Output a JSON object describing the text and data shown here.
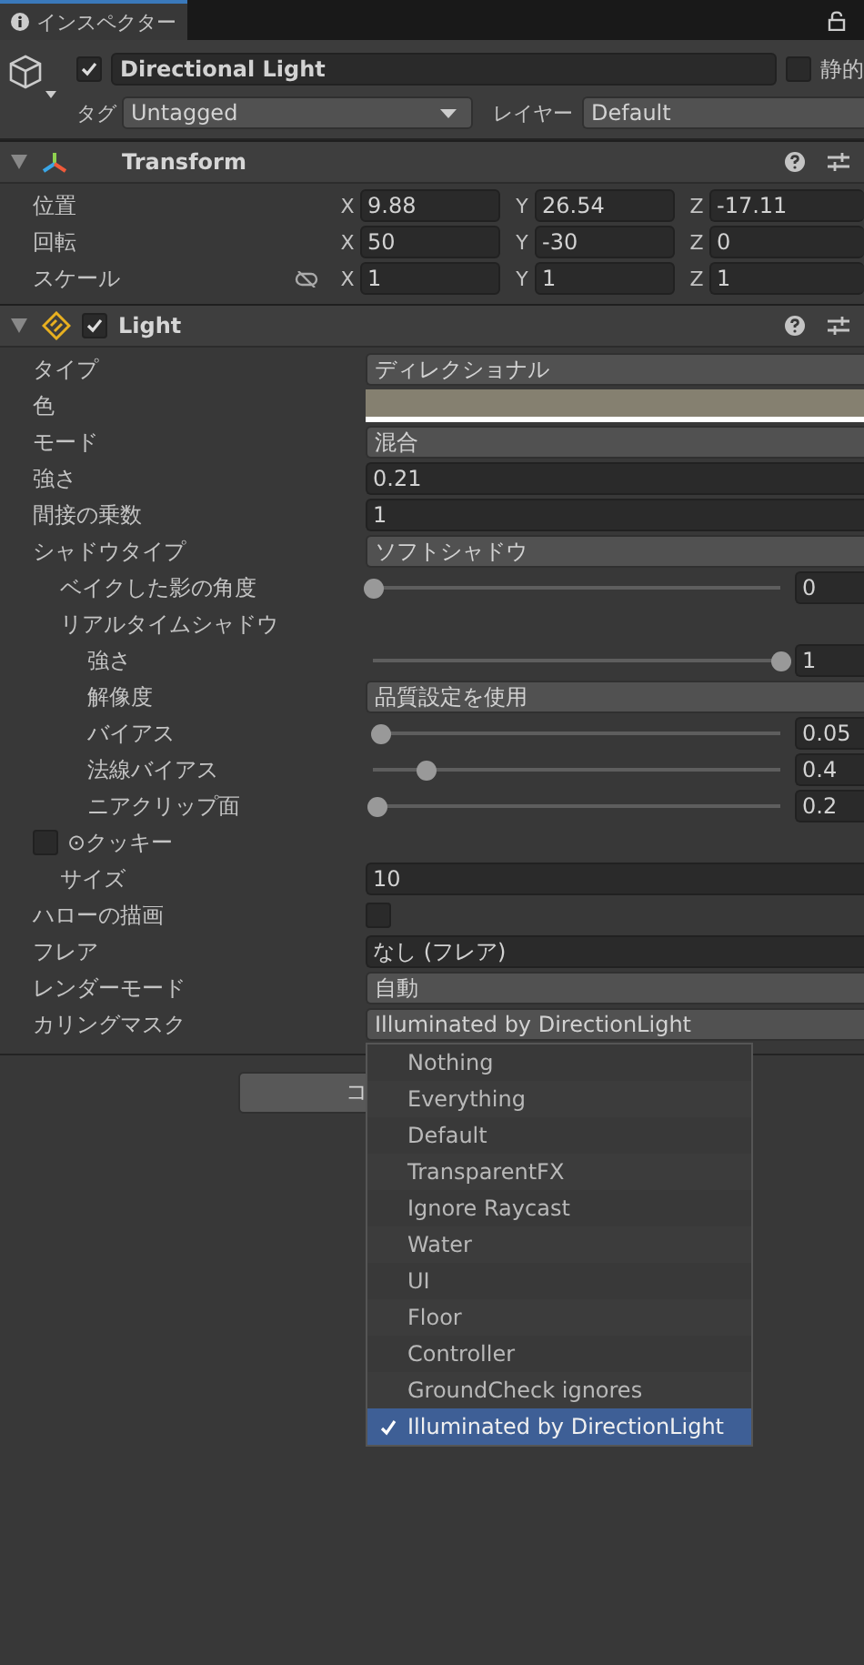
{
  "tab": {
    "label": "インスペクター"
  },
  "object": {
    "active": true,
    "name": "Directional Light",
    "static_label": "静的",
    "static": false,
    "tag_label": "タグ",
    "tag": "Untagged",
    "layer_label": "レイヤー",
    "layer": "Default"
  },
  "components": [
    {
      "kind": "transform",
      "title": "Transform",
      "expanded": true,
      "rows": [
        {
          "label": "位置",
          "fields": [
            {
              "axis": "X",
              "value": "9.88"
            },
            {
              "axis": "Y",
              "value": "26.54"
            },
            {
              "axis": "Z",
              "value": "-17.11"
            }
          ]
        },
        {
          "label": "回転",
          "fields": [
            {
              "axis": "X",
              "value": "50"
            },
            {
              "axis": "Y",
              "value": "-30"
            },
            {
              "axis": "Z",
              "value": "0"
            }
          ]
        },
        {
          "label": "スケール",
          "constrained": false,
          "fields": [
            {
              "axis": "X",
              "value": "1"
            },
            {
              "axis": "Y",
              "value": "1"
            },
            {
              "axis": "Z",
              "value": "1"
            }
          ]
        }
      ]
    },
    {
      "kind": "light",
      "title": "Light",
      "expanded": true,
      "enabled": true,
      "properties": [
        {
          "kind": "dropdown",
          "label": "タイプ",
          "value": "ディレクショナル"
        },
        {
          "kind": "color",
          "label": "色",
          "color": "#858070"
        },
        {
          "kind": "dropdown",
          "label": "モード",
          "value": "混合"
        },
        {
          "kind": "number",
          "label": "強さ",
          "value": "0.21"
        },
        {
          "kind": "number",
          "label": "間接の乗数",
          "value": "1"
        },
        {
          "kind": "dropdown",
          "label": "シャドウタイプ",
          "value": "ソフトシャドウ",
          "children": [
            {
              "kind": "slider",
              "label": "ベイクした影の角度",
              "level": 0,
              "value": "0"
            },
            {
              "kind": "group",
              "label": "リアルタイムシャドウ",
              "children": [
                {
                  "kind": "slider",
                  "label": "強さ",
                  "level": 1,
                  "value": "1"
                },
                {
                  "kind": "dropdown",
                  "label": "解像度",
                  "value": "品質設定を使用"
                },
                {
                  "kind": "slider",
                  "label": "バイアス",
                  "level": 0.02,
                  "value": "0.05"
                },
                {
                  "kind": "slider",
                  "label": "法線バイアス",
                  "level": 0.13,
                  "value": "0.4"
                },
                {
                  "kind": "slider",
                  "label": "ニアクリップ面",
                  "level": 0.01,
                  "value": "0.2"
                }
              ]
            }
          ]
        },
        {
          "kind": "toggle-group",
          "label": "⊙クッキー",
          "checked": false,
          "children": [
            {
              "kind": "number",
              "label": "サイズ",
              "value": "10"
            }
          ]
        },
        {
          "kind": "checkbox",
          "label": "ハローの描画",
          "checked": false
        },
        {
          "kind": "object",
          "label": "フレア",
          "value": "なし (フレア)"
        },
        {
          "kind": "dropdown",
          "label": "レンダーモード",
          "value": "自動"
        },
        {
          "kind": "mask",
          "label": "カリングマスク",
          "value": "Illuminated by DirectionLight"
        }
      ]
    }
  ],
  "add_button": {
    "label": "コ"
  },
  "mask_menu": {
    "items": [
      {
        "label": "Nothing",
        "selected": false
      },
      {
        "label": "Everything",
        "selected": false
      },
      {
        "label": "Default",
        "selected": false
      },
      {
        "label": "TransparentFX",
        "selected": false
      },
      {
        "label": "Ignore Raycast",
        "selected": false
      },
      {
        "label": "Water",
        "selected": false
      },
      {
        "label": "UI",
        "selected": false
      },
      {
        "label": "Floor",
        "selected": false
      },
      {
        "label": "Controller",
        "selected": false
      },
      {
        "label": "GroundCheck ignores",
        "selected": false
      },
      {
        "label": "Illuminated by DirectionLight",
        "selected": true
      }
    ]
  }
}
